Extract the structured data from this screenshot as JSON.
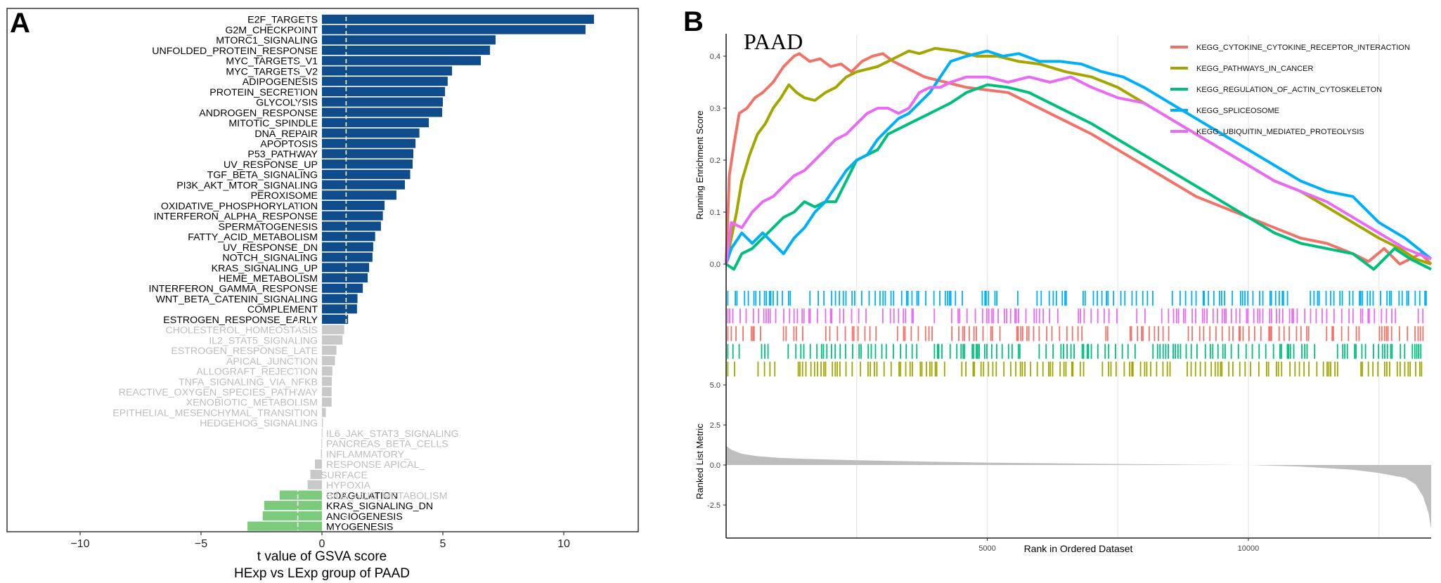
{
  "chart_data": [
    {
      "panel_label": "A",
      "type": "bar",
      "orientation": "horizontal",
      "xlabel": "t value of GSVA score",
      "xlabel2": "HExp vs LExp group of PAAD",
      "xlim": [
        -13,
        13.1
      ],
      "xticks": [
        -10,
        -5,
        0,
        5,
        10
      ],
      "xtick_labels": [
        "−10",
        "−5",
        "0",
        "5",
        "10"
      ],
      "threshold_lines": [
        -1,
        1
      ],
      "colors": {
        "up": "#0F4C8C",
        "down": "#7CCB7C",
        "ns": "#C8C8C8",
        "label_sig": "#000000",
        "label_ns": "#BDBDBD"
      },
      "categories": [
        "E2F_TARGETS",
        "G2M_CHECKPOINT",
        "MTORC1_SIGNALING",
        "UNFOLDED_PROTEIN_RESPONSE",
        "MYC_TARGETS_V1",
        "MYC_TARGETS_V2",
        "ADIPOGENESIS",
        "PROTEIN_SECRETION",
        "GLYCOLYSIS",
        "ANDROGEN_RESPONSE",
        "MITOTIC_SPINDLE",
        "DNA_REPAIR",
        "APOPTOSIS",
        "P53_PATHWAY",
        "UV_RESPONSE_UP",
        "TGF_BETA_SIGNALING",
        "PI3K_AKT_MTOR_SIGNALING",
        "PEROXISOME",
        "OXIDATIVE_PHOSPHORYLATION",
        "INTERFERON_ALPHA_RESPONSE",
        "SPERMATOGENESIS",
        "FATTY_ACID_METABOLISM",
        "UV_RESPONSE_DN",
        "NOTCH_SIGNALING",
        "KRAS_SIGNALING_UP",
        "HEME_METABOLISM",
        "INTERFERON_GAMMA_RESPONSE",
        "WNT_BETA_CATENIN_SIGNALING",
        "COMPLEMENT",
        "ESTROGEN_RESPONSE_EARLY",
        "CHOLESTEROL_HOMEOSTASIS",
        "IL2_STAT5_SIGNALING",
        "ESTROGEN_RESPONSE_LATE",
        "APICAL_JUNCTION",
        "ALLOGRAFT_REJECTION",
        "TNFA_SIGNALING_VIA_NFKB",
        "REACTIVE_OXYGEN_SPECIES_PATHWAY",
        "XENOBIOTIC_METABOLISM",
        "EPITHELIAL_MESENCHYMAL_TRANSITION",
        "HEDGEHOG_SIGNALING",
        "IL6_JAK_STAT3_SIGNALING",
        "PANCREAS_BETA_CELLS",
        "INFLAMMATORY_RESPONSE",
        "APICAL_SURFACE",
        "HYPOXIA",
        "BILE_ACID_METABOLISM",
        "COAGULATION",
        "KRAS_SIGNALING_DN",
        "ANGIOGENESIS",
        "MYOGENESIS"
      ],
      "values": [
        11.25,
        10.9,
        7.18,
        6.95,
        6.57,
        5.38,
        5.2,
        5.09,
        5.0,
        4.97,
        4.42,
        4.03,
        3.87,
        3.78,
        3.75,
        3.65,
        3.43,
        3.08,
        2.59,
        2.52,
        2.44,
        2.2,
        2.12,
        2.09,
        1.95,
        1.89,
        1.69,
        1.47,
        1.45,
        1.08,
        0.92,
        0.85,
        0.6,
        0.54,
        0.43,
        0.41,
        0.4,
        0.4,
        0.16,
        0.04,
        -0.01,
        -0.02,
        -0.04,
        -0.29,
        -0.48,
        -0.59,
        -1.75,
        -2.39,
        -2.45,
        -3.08
      ],
      "wrapped_negative_labels": [
        "IL6_JAK_STAT3_SIGNALING",
        "PANCREAS_BETA_CELLS",
        "INFLAMMATORY_",
        "RESPONSE  APICAL_",
        "SURFACE",
        "HYPOXIA",
        "BILE_ACID_METABOLISM"
      ]
    },
    {
      "panel_label": "B",
      "type": "line",
      "title": "PAAD",
      "ylabel": "Running Enrichment Score",
      "ylabel2": "Ranked List Metric",
      "xlabel": "Rank in Ordered Dataset",
      "xlim": [
        0,
        13500
      ],
      "xticks": [
        5000,
        10000
      ],
      "xtick_labels": [
        "5000",
        "10000"
      ],
      "x_gridlines": [
        2500,
        5000,
        7500,
        10000,
        12500
      ],
      "ylim": [
        -0.02,
        0.44
      ],
      "yticks": [
        0.0,
        0.1,
        0.2,
        0.3,
        0.4
      ],
      "ytick_labels": [
        "0.0",
        "0.1",
        "0.2",
        "0.3",
        "0.4"
      ],
      "metric_ylim": [
        -4.6,
        5.8
      ],
      "metric_yticks": [
        5.0,
        2.5,
        0.0,
        -2.5
      ],
      "metric_ytick_labels": [
        "5.0",
        "2.5",
        "0.0",
        "-2.5"
      ],
      "legend_position": "top-right",
      "rug_order": [
        "KEGG_SPLICEOSOME",
        "KEGG_UBIQUITIN_MEDIATED_PROTEOLYSIS",
        "KEGG_CYTOKINE_CYTOKINE_RECEPTOR_INTERACTION",
        "KEGG_REGULATION_OF_ACTIN_CYTOSKELETON",
        "KEGG_PATHWAYS_IN_CANCER"
      ],
      "series": [
        {
          "name": "KEGG_CYTOKINE_CYTOKINE_RECEPTOR_INTERACTION",
          "color": "#F0736A",
          "x": [
            0,
            60,
            150,
            250,
            400,
            550,
            700,
            900,
            1100,
            1300,
            1400,
            1600,
            1800,
            2000,
            2200,
            2400,
            2600,
            2800,
            3000,
            3200,
            3400,
            3600,
            3800,
            4200,
            4600,
            5000,
            5400,
            5800,
            6200,
            6600,
            7000,
            7500,
            8000,
            8500,
            9000,
            9500,
            10000,
            10500,
            11000,
            11500,
            12000,
            12300,
            12600,
            12900,
            13300,
            13500
          ],
          "y": [
            0.0,
            0.17,
            0.23,
            0.29,
            0.3,
            0.32,
            0.33,
            0.35,
            0.38,
            0.4,
            0.405,
            0.39,
            0.395,
            0.38,
            0.385,
            0.37,
            0.39,
            0.4,
            0.405,
            0.39,
            0.38,
            0.37,
            0.36,
            0.35,
            0.34,
            0.335,
            0.33,
            0.31,
            0.29,
            0.27,
            0.25,
            0.22,
            0.19,
            0.16,
            0.13,
            0.11,
            0.09,
            0.07,
            0.05,
            0.04,
            0.02,
            0.005,
            0.03,
            0.0,
            0.02,
            0.0
          ]
        },
        {
          "name": "KEGG_PATHWAYS_IN_CANCER",
          "color": "#A3A500",
          "x": [
            0,
            80,
            200,
            300,
            450,
            600,
            750,
            900,
            1050,
            1200,
            1350,
            1500,
            1700,
            1900,
            2100,
            2300,
            2500,
            2700,
            2900,
            3100,
            3300,
            3500,
            3700,
            4000,
            4400,
            4800,
            5200,
            5600,
            6000,
            6500,
            7000,
            7500,
            8000,
            8500,
            9000,
            9500,
            10000,
            10500,
            11000,
            11500,
            12000,
            12500,
            12900,
            13200,
            13500
          ],
          "y": [
            0.0,
            0.04,
            0.1,
            0.16,
            0.21,
            0.25,
            0.27,
            0.3,
            0.32,
            0.345,
            0.33,
            0.32,
            0.315,
            0.33,
            0.34,
            0.36,
            0.37,
            0.375,
            0.38,
            0.39,
            0.4,
            0.41,
            0.405,
            0.415,
            0.41,
            0.4,
            0.4,
            0.39,
            0.385,
            0.37,
            0.36,
            0.34,
            0.31,
            0.28,
            0.25,
            0.22,
            0.19,
            0.16,
            0.14,
            0.11,
            0.08,
            0.05,
            0.03,
            0.01,
            0.0
          ]
        },
        {
          "name": "KEGG_REGULATION_OF_ACTIN_CYTOSKELETON",
          "color": "#00BF7D",
          "x": [
            0,
            150,
            300,
            500,
            700,
            900,
            1100,
            1300,
            1500,
            1700,
            1900,
            2100,
            2300,
            2500,
            2700,
            2900,
            3100,
            3300,
            3500,
            3700,
            3900,
            4100,
            4300,
            4600,
            5000,
            5400,
            5800,
            6200,
            6600,
            7000,
            7500,
            8000,
            8500,
            9000,
            9500,
            10000,
            10500,
            11000,
            11500,
            12000,
            12400,
            12800,
            13100,
            13500
          ],
          "y": [
            0.0,
            -0.01,
            0.02,
            0.03,
            0.05,
            0.07,
            0.09,
            0.1,
            0.12,
            0.11,
            0.12,
            0.12,
            0.16,
            0.2,
            0.21,
            0.22,
            0.25,
            0.26,
            0.27,
            0.28,
            0.29,
            0.3,
            0.31,
            0.33,
            0.345,
            0.34,
            0.33,
            0.31,
            0.29,
            0.27,
            0.24,
            0.21,
            0.18,
            0.15,
            0.12,
            0.09,
            0.06,
            0.04,
            0.03,
            0.02,
            -0.01,
            0.03,
            0.01,
            -0.01
          ]
        },
        {
          "name": "KEGG_SPLICEOSOME",
          "color": "#00B0F6",
          "x": [
            0,
            100,
            300,
            500,
            700,
            900,
            1100,
            1300,
            1500,
            1700,
            1900,
            2100,
            2300,
            2500,
            2700,
            2900,
            3100,
            3300,
            3500,
            3700,
            3900,
            4100,
            4300,
            4600,
            5000,
            5300,
            5600,
            6000,
            6400,
            6800,
            7200,
            7600,
            8000,
            8500,
            9000,
            9500,
            10000,
            10500,
            11000,
            11500,
            12000,
            12500,
            13000,
            13500
          ],
          "y": [
            0.0,
            0.03,
            0.06,
            0.04,
            0.06,
            0.04,
            0.02,
            0.05,
            0.07,
            0.1,
            0.12,
            0.15,
            0.18,
            0.2,
            0.21,
            0.24,
            0.26,
            0.28,
            0.29,
            0.31,
            0.33,
            0.36,
            0.39,
            0.4,
            0.41,
            0.4,
            0.405,
            0.39,
            0.39,
            0.385,
            0.37,
            0.36,
            0.34,
            0.31,
            0.28,
            0.25,
            0.22,
            0.19,
            0.16,
            0.14,
            0.13,
            0.08,
            0.05,
            0.01
          ]
        },
        {
          "name": "KEGG_UBIQUITIN_MEDIATED_PROTEOLYSIS",
          "color": "#E76BF3",
          "x": [
            0,
            100,
            300,
            500,
            700,
            900,
            1100,
            1300,
            1500,
            1700,
            1900,
            2100,
            2300,
            2500,
            2700,
            2900,
            3100,
            3300,
            3500,
            3700,
            3900,
            4100,
            4300,
            4600,
            5000,
            5400,
            5800,
            6200,
            6600,
            7000,
            7500,
            8000,
            8500,
            9000,
            9500,
            10000,
            10500,
            11000,
            11500,
            12000,
            12500,
            13000,
            13500
          ],
          "y": [
            0.0,
            0.08,
            0.07,
            0.1,
            0.12,
            0.13,
            0.15,
            0.17,
            0.18,
            0.2,
            0.22,
            0.24,
            0.25,
            0.27,
            0.29,
            0.3,
            0.3,
            0.29,
            0.3,
            0.33,
            0.34,
            0.34,
            0.35,
            0.36,
            0.36,
            0.35,
            0.36,
            0.35,
            0.36,
            0.34,
            0.32,
            0.31,
            0.28,
            0.25,
            0.22,
            0.19,
            0.16,
            0.14,
            0.12,
            0.09,
            0.06,
            0.03,
            0.01
          ]
        }
      ],
      "ranked_metric": {
        "color": "#BEBEBE",
        "x": [
          0,
          100,
          300,
          600,
          1000,
          1500,
          2500,
          4000,
          5000,
          7000,
          9000,
          10000,
          11000,
          12000,
          12500,
          13000,
          13200,
          13350,
          13450,
          13500
        ],
        "y": [
          1.2,
          0.95,
          0.7,
          0.55,
          0.45,
          0.38,
          0.3,
          0.2,
          0.15,
          0.08,
          0.02,
          0.0,
          -0.1,
          -0.3,
          -0.5,
          -0.8,
          -1.2,
          -2.0,
          -3.0,
          -4.0
        ]
      }
    }
  ]
}
